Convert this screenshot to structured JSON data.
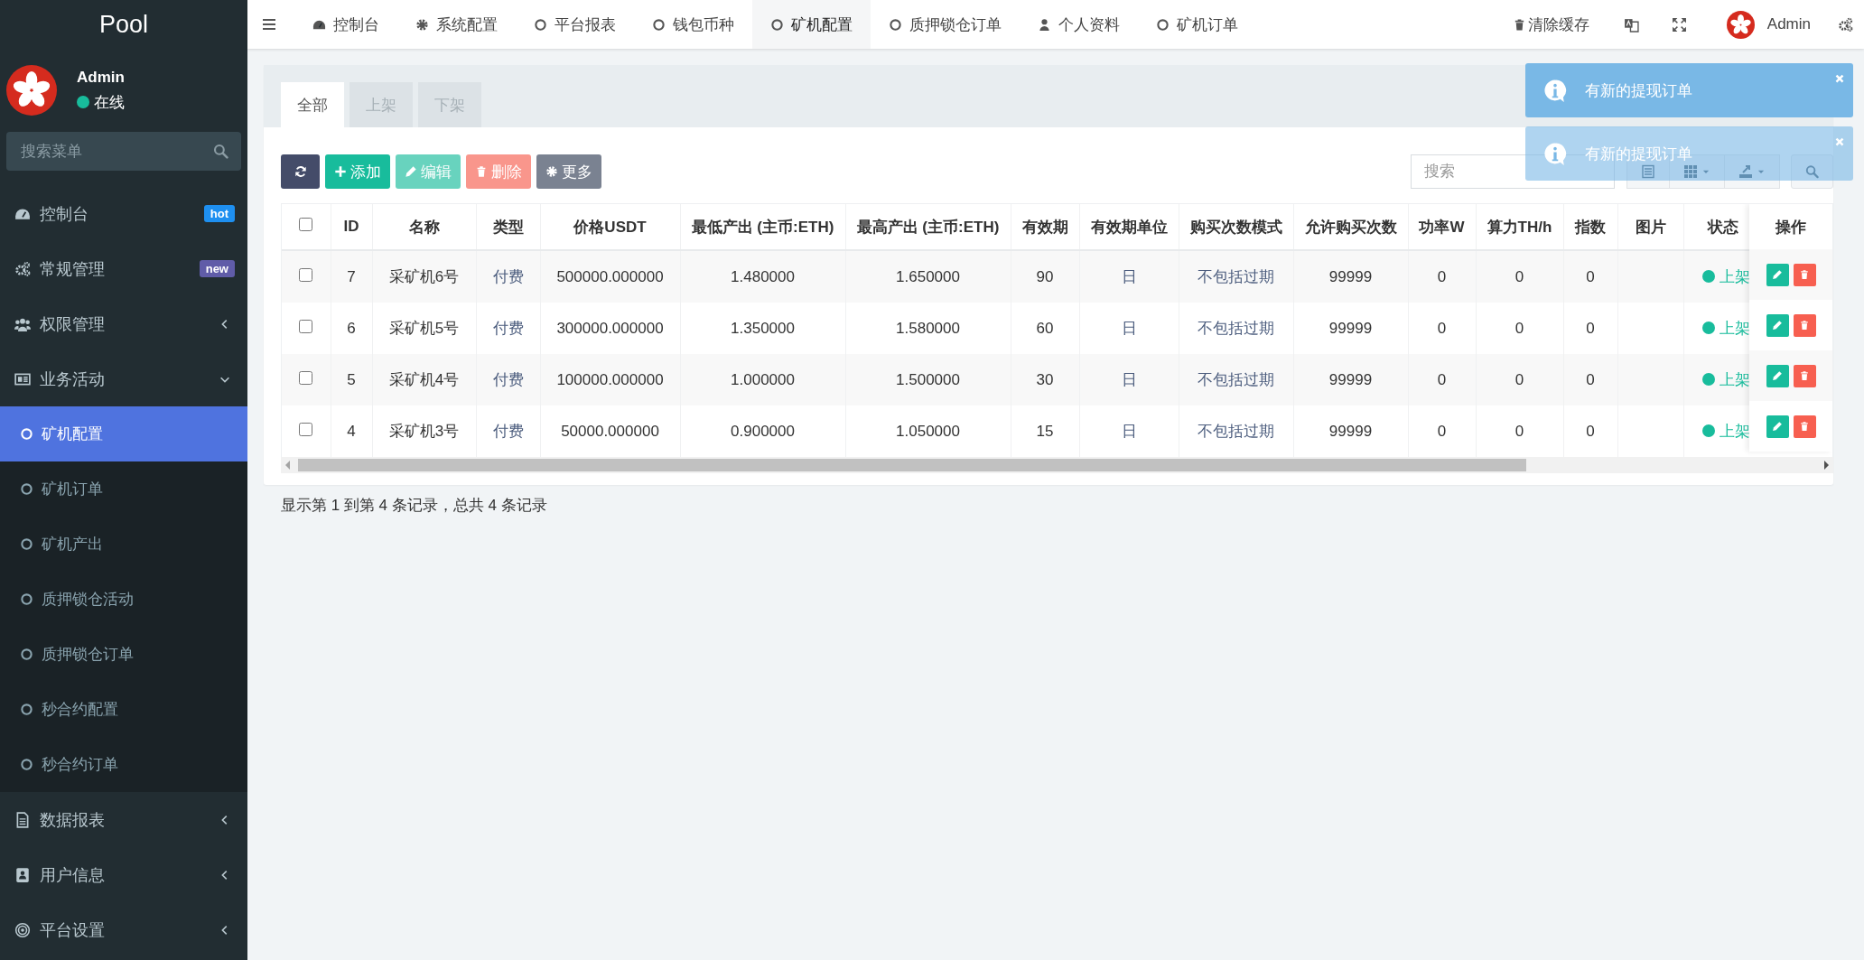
{
  "sidebar": {
    "logo": "Pool",
    "user": {
      "name": "Admin",
      "status": "在线"
    },
    "search": {
      "placeholder": "搜索菜单"
    },
    "menu": [
      {
        "label": "控制台",
        "badge": {
          "text": "hot",
          "color": "#1e8ff0"
        }
      },
      {
        "label": "常规管理",
        "badge": {
          "text": "new",
          "color": "#605ca8"
        }
      },
      {
        "label": "权限管理",
        "expanded": false
      },
      {
        "label": "业务活动",
        "expanded": true,
        "children": [
          {
            "label": "矿机配置",
            "selected": true
          },
          {
            "label": "矿机订单",
            "selected": false
          },
          {
            "label": "矿机产出",
            "selected": false
          },
          {
            "label": "质押锁仓活动",
            "selected": false
          },
          {
            "label": "质押锁仓订单",
            "selected": false
          },
          {
            "label": "秒合约配置",
            "selected": false
          },
          {
            "label": "秒合约订单",
            "selected": false
          }
        ]
      },
      {
        "label": "数据报表",
        "expanded": false
      },
      {
        "label": "用户信息",
        "expanded": false
      },
      {
        "label": "平台设置",
        "expanded": false
      }
    ]
  },
  "topbar": {
    "tabs": [
      {
        "label": "控制台",
        "selected": false
      },
      {
        "label": "系统配置",
        "selected": false
      },
      {
        "label": "平台报表",
        "selected": false
      },
      {
        "label": "钱包币种",
        "selected": false
      },
      {
        "label": "矿机配置",
        "selected": true
      },
      {
        "label": "质押锁仓订单",
        "selected": false
      },
      {
        "label": "个人资料",
        "selected": false
      },
      {
        "label": "矿机订单",
        "selected": false
      }
    ],
    "clear_cache": "清除缓存",
    "user": "Admin"
  },
  "notifications": [
    {
      "text": "有新的提现订单",
      "fading": false
    },
    {
      "text": "有新的提现订单",
      "fading": true
    }
  ],
  "panel": {
    "tabs": [
      {
        "label": "全部",
        "selected": true
      },
      {
        "label": "上架",
        "selected": false
      },
      {
        "label": "下架",
        "selected": false
      }
    ],
    "toolbar": {
      "buttons": [
        {
          "kind": "add",
          "label": "添加",
          "disabled": false
        },
        {
          "kind": "edit",
          "label": "编辑",
          "disabled": true
        },
        {
          "kind": "delete",
          "label": "删除",
          "disabled": true
        },
        {
          "kind": "more",
          "label": "更多",
          "disabled": false
        }
      ],
      "search": {
        "placeholder": "搜索"
      }
    },
    "table": {
      "select_all": {
        "checked": false
      },
      "columns": [
        "ID",
        "名称",
        "类型",
        "价格USDT",
        "最低产出 (主币:ETH)",
        "最高产出 (主币:ETH)",
        "有效期",
        "有效期单位",
        "购买次数模式",
        "允许购买次数",
        "功率W",
        "算力TH/h",
        "指数",
        "图片",
        "状态",
        "操作"
      ],
      "rows": [
        {
          "checked": false,
          "cells": [
            "7",
            "采矿机6号",
            "付费",
            "500000.000000",
            "1.480000",
            "1.650000",
            "90",
            "日",
            "不包括过期",
            "99999",
            "0",
            "0",
            "0"
          ],
          "status": "上架"
        },
        {
          "checked": false,
          "cells": [
            "6",
            "采矿机5号",
            "付费",
            "300000.000000",
            "1.350000",
            "1.580000",
            "60",
            "日",
            "不包括过期",
            "99999",
            "0",
            "0",
            "0"
          ],
          "status": "上架"
        },
        {
          "checked": false,
          "cells": [
            "5",
            "采矿机4号",
            "付费",
            "100000.000000",
            "1.000000",
            "1.500000",
            "30",
            "日",
            "不包括过期",
            "99999",
            "0",
            "0",
            "0"
          ],
          "status": "上架"
        },
        {
          "checked": false,
          "cells": [
            "4",
            "采矿机3号",
            "付费",
            "50000.000000",
            "0.900000",
            "1.050000",
            "15",
            "日",
            "不包括过期",
            "99999",
            "0",
            "0",
            "0"
          ],
          "status": "上架"
        }
      ]
    },
    "footer": "显示第 1 到第 4 条记录，总共 4 条记录"
  }
}
